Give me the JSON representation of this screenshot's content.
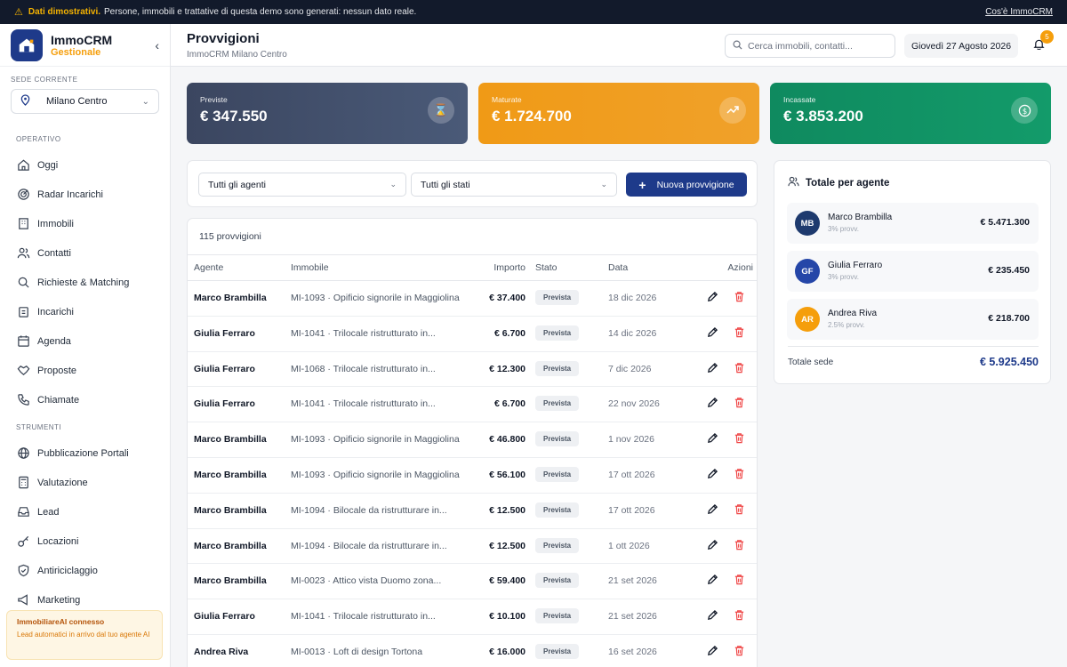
{
  "banner": {
    "bold": "Dati dimostrativi.",
    "text": "Persone, immobili e trattative di questa demo sono generati: nessun dato reale.",
    "link": "Cos'è ImmoCRM"
  },
  "brand": {
    "name": "ImmoCRM",
    "sub": "Gestionale"
  },
  "sede": {
    "label": "SEDE CORRENTE",
    "value": "Milano Centro"
  },
  "nav": {
    "operativo_label": "OPERATIVO",
    "operativo": [
      {
        "label": "Oggi",
        "icon": "home-icon"
      },
      {
        "label": "Radar Incarichi",
        "icon": "radar-icon"
      },
      {
        "label": "Immobili",
        "icon": "building-icon"
      },
      {
        "label": "Contatti",
        "icon": "users-icon"
      },
      {
        "label": "Richieste & Matching",
        "icon": "search-icon"
      },
      {
        "label": "Incarichi",
        "icon": "clipboard-icon"
      },
      {
        "label": "Agenda",
        "icon": "calendar-icon"
      },
      {
        "label": "Proposte",
        "icon": "handshake-icon"
      },
      {
        "label": "Chiamate",
        "icon": "phone-icon"
      }
    ],
    "strumenti_label": "STRUMENTI",
    "strumenti": [
      {
        "label": "Pubblicazione Portali",
        "icon": "globe-icon"
      },
      {
        "label": "Valutazione",
        "icon": "calculator-icon"
      },
      {
        "label": "Lead",
        "icon": "inbox-icon"
      },
      {
        "label": "Locazioni",
        "icon": "key-icon"
      },
      {
        "label": "Antiriciclaggio",
        "icon": "shield-icon"
      },
      {
        "label": "Marketing",
        "icon": "megaphone-icon"
      }
    ]
  },
  "ai_box": {
    "title": "ImmobiliareAI connesso",
    "desc": "Lead automatici in arrivo dal tuo agente AI"
  },
  "header": {
    "title": "Provvigioni",
    "subtitle": "ImmoCRM Milano Centro",
    "search_placeholder": "Cerca immobili, contatti...",
    "date": "Giovedì 27 Agosto 2026",
    "notifications": "5"
  },
  "kpis": [
    {
      "label": "Previste",
      "value": "€ 347.550",
      "icon": "hourglass-icon",
      "color": "#3b4660"
    },
    {
      "label": "Maturate",
      "value": "€ 1.724.700",
      "icon": "trending-up-icon",
      "color": "#f09a16"
    },
    {
      "label": "Incassate",
      "value": "€ 3.853.200",
      "icon": "dollar-icon",
      "color": "#0f8a5f"
    }
  ],
  "filters": {
    "agent": "Tutti gli agenti",
    "state": "Tutti gli stati",
    "new_button": "Nuova provvigione"
  },
  "table": {
    "count": "115 provvigioni",
    "headers": [
      "Agente",
      "Immobile",
      "Importo",
      "Stato",
      "Data",
      "Azioni"
    ],
    "rows": [
      {
        "agent": "Marco Brambilla",
        "property": "MI-1093 · Opificio signorile in Maggiolina",
        "amount": "€ 37.400",
        "status": "Prevista",
        "date": "18 dic 2026"
      },
      {
        "agent": "Giulia Ferraro",
        "property": "MI-1041 · Trilocale ristrutturato in...",
        "amount": "€ 6.700",
        "status": "Prevista",
        "date": "14 dic 2026"
      },
      {
        "agent": "Giulia Ferraro",
        "property": "MI-1068 · Trilocale ristrutturato in...",
        "amount": "€ 12.300",
        "status": "Prevista",
        "date": "7 dic 2026"
      },
      {
        "agent": "Giulia Ferraro",
        "property": "MI-1041 · Trilocale ristrutturato in...",
        "amount": "€ 6.700",
        "status": "Prevista",
        "date": "22 nov 2026"
      },
      {
        "agent": "Marco Brambilla",
        "property": "MI-1093 · Opificio signorile in Maggiolina",
        "amount": "€ 46.800",
        "status": "Prevista",
        "date": "1 nov 2026"
      },
      {
        "agent": "Marco Brambilla",
        "property": "MI-1093 · Opificio signorile in Maggiolina",
        "amount": "€ 56.100",
        "status": "Prevista",
        "date": "17 ott 2026"
      },
      {
        "agent": "Marco Brambilla",
        "property": "MI-1094 · Bilocale da ristrutturare in...",
        "amount": "€ 12.500",
        "status": "Prevista",
        "date": "17 ott 2026"
      },
      {
        "agent": "Marco Brambilla",
        "property": "MI-1094 · Bilocale da ristrutturare in...",
        "amount": "€ 12.500",
        "status": "Prevista",
        "date": "1 ott 2026"
      },
      {
        "agent": "Marco Brambilla",
        "property": "MI-0023 · Attico vista Duomo zona...",
        "amount": "€ 59.400",
        "status": "Prevista",
        "date": "21 set 2026"
      },
      {
        "agent": "Giulia Ferraro",
        "property": "MI-1041 · Trilocale ristrutturato in...",
        "amount": "€ 10.100",
        "status": "Prevista",
        "date": "21 set 2026"
      },
      {
        "agent": "Andrea Riva",
        "property": "MI-0013 · Loft di design Tortona",
        "amount": "€ 16.000",
        "status": "Prevista",
        "date": "16 set 2026"
      }
    ]
  },
  "agents_panel": {
    "title": "Totale per agente",
    "agents": [
      {
        "initials": "MB",
        "name": "Marco Brambilla",
        "pct": "3% provv.",
        "amount": "€ 5.471.300",
        "color": "#1e3a6e"
      },
      {
        "initials": "GF",
        "name": "Giulia Ferraro",
        "pct": "3% provv.",
        "amount": "€ 235.450",
        "color": "#2546a8"
      },
      {
        "initials": "AR",
        "name": "Andrea Riva",
        "pct": "2.5% provv.",
        "amount": "€ 218.700",
        "color": "#f59e0b"
      }
    ],
    "total_label": "Totale sede",
    "total_value": "€ 5.925.450"
  }
}
